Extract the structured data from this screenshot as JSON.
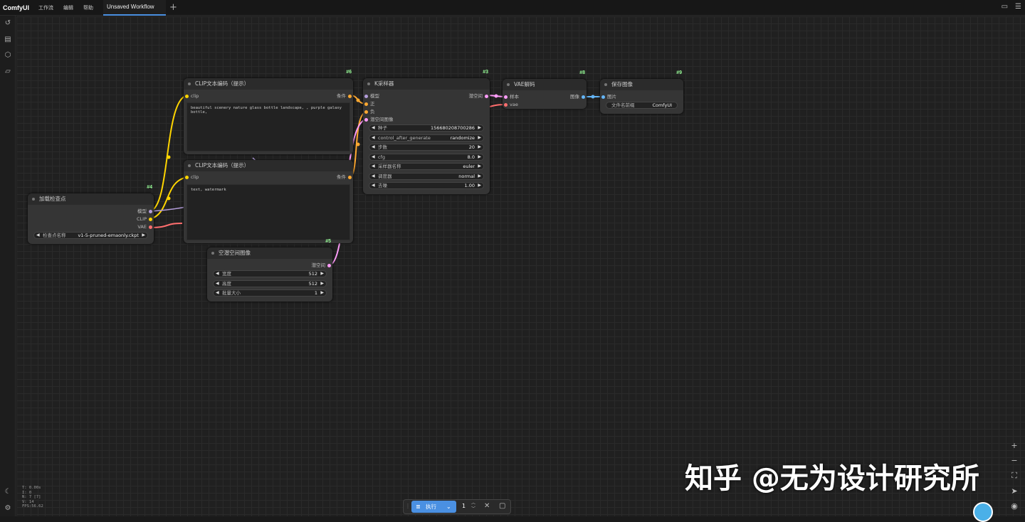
{
  "app": {
    "brand": "ComfyUI"
  },
  "menu": [
    "工作流",
    "编辑",
    "帮助"
  ],
  "tab": {
    "title": "Unsaved Workflow",
    "add_label": "+"
  },
  "nodes": {
    "clip_pos": {
      "id": "#6",
      "title": "CLIP文本编码（提示）",
      "in_clip": "clip",
      "out_cond": "条件",
      "text": "beautiful scenery nature glass bottle landscape, , purple galaxy bottle,"
    },
    "clip_neg": {
      "id": "",
      "title": "CLIP文本编码（提示）",
      "in_clip": "clip",
      "out_cond": "条件",
      "text": "text, watermark"
    },
    "ksampler": {
      "id": "#3",
      "title": "K采样器",
      "in_model": "模型",
      "in_pos": "正",
      "in_neg": "负",
      "in_latent": "潜空间图像",
      "out_latent": "潜空间",
      "w_seed_l": "种子",
      "w_seed_v": "156680208700286",
      "w_cag_l": "control_after_generate",
      "w_cag_v": "randomize",
      "w_steps_l": "步数",
      "w_steps_v": "20",
      "w_cfg_l": "cfg",
      "w_cfg_v": "8.0",
      "w_sampler_l": "采样器名称",
      "w_sampler_v": "euler",
      "w_sched_l": "调度器",
      "w_sched_v": "normal",
      "w_denoise_l": "去噪",
      "w_denoise_v": "1.00"
    },
    "vae_decode": {
      "id": "#8",
      "title": "VAE解码",
      "in_samples": "样本",
      "in_vae": "vae",
      "out_image": "图像"
    },
    "save_image": {
      "id": "#9",
      "title": "保存图像",
      "in_images": "图片",
      "w_prefix_l": "文件名前缀",
      "w_prefix_v": "ComfyUI"
    },
    "ckpt": {
      "id": "#4",
      "title": "加载检查点",
      "out_model": "模型",
      "out_clip": "CLIP",
      "out_vae": "VAE",
      "w_ckpt_l": "检查点名称",
      "w_ckpt_v": "v1-5-pruned-emaonly.ckpt"
    },
    "empty_latent": {
      "id": "#5",
      "title": "空潜空间图像",
      "out_latent": "潜空间",
      "w_w_l": "宽度",
      "w_w_v": "512",
      "w_h_l": "高度",
      "w_h_v": "512",
      "w_b_l": "批量大小",
      "w_b_v": "1"
    }
  },
  "stats": [
    "T: 0.00s",
    "I: 0",
    "N: 7 [7]",
    "V: 14",
    "FPS:56.62"
  ],
  "exec": {
    "label": "执行",
    "count": "1"
  },
  "watermark": "知乎 @无为设计研究所",
  "colors": {
    "accent": "#4a90e2",
    "clip_link": "#ffd500",
    "model_link": "#b39ddb",
    "vae_link": "#ff6e6e",
    "latent_link": "#ff9cf9",
    "image_link": "#64b5f6",
    "cond_link": "#ffa931"
  },
  "icons": [
    "history-icon",
    "list-icon",
    "cube-icon",
    "folder-icon",
    "moon-icon",
    "settings-icon",
    "zoom-in-icon",
    "zoom-out-icon",
    "fit-view-icon",
    "pointer-icon",
    "eye-icon",
    "panel-icon",
    "menu-icon"
  ]
}
